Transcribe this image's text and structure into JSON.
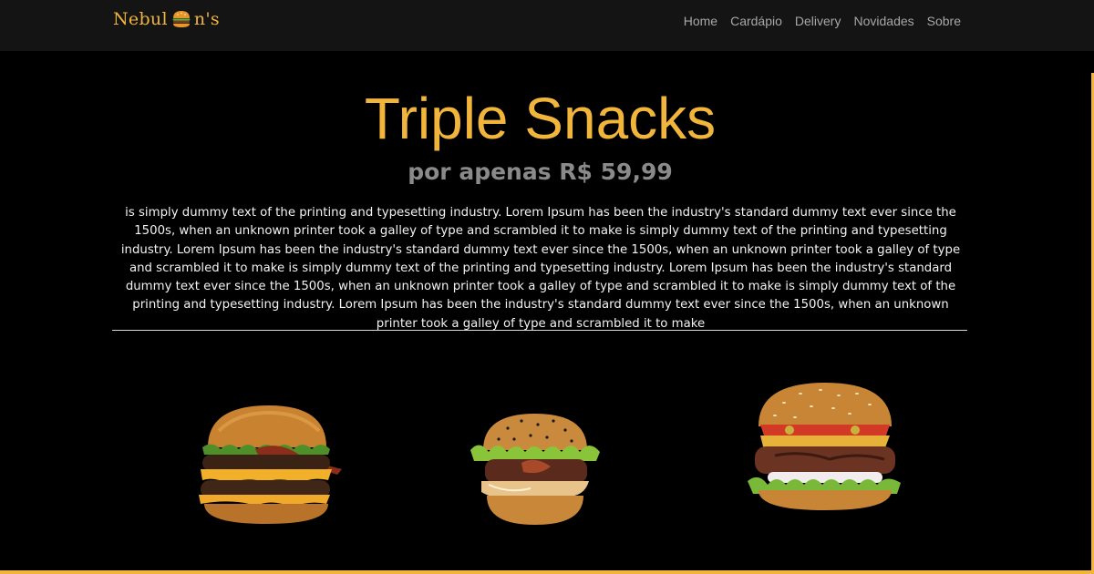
{
  "brand": {
    "name_start": "Nebul",
    "name_end": "n's",
    "logo_icon": "burger-icon"
  },
  "nav": {
    "items": [
      {
        "label": "Home"
      },
      {
        "label": "Cardápio"
      },
      {
        "label": "Delivery"
      },
      {
        "label": "Novidades"
      },
      {
        "label": "Sobre"
      }
    ]
  },
  "hero": {
    "title": "Triple Snacks",
    "subtitle": "por apenas R$ 59,99",
    "description": "is simply dummy text of the printing and typesetting industry. Lorem Ipsum has been the industry's standard dummy text ever since the 1500s, when an unknown printer took a galley of type and scrambled it to make is simply dummy text of the printing and typesetting industry. Lorem Ipsum has been the industry's standard dummy text ever since the 1500s, when an unknown printer took a galley of type and scrambled it to make is simply dummy text of the printing and typesetting industry. Lorem Ipsum has been the industry's standard dummy text ever since the 1500s, when an unknown printer took a galley of type and scrambled it to make is simply dummy text of the printing and typesetting industry. Lorem Ipsum has been the industry's standard dummy text ever since the 1500s, when an unknown printer took a galley of type and scrambled it to make"
  },
  "images": [
    {
      "name": "burger-image-1",
      "icon": "double-cheeseburger-image"
    },
    {
      "name": "burger-image-2",
      "icon": "burger-with-sauce-image"
    },
    {
      "name": "burger-image-3",
      "icon": "cheeseburger-image"
    }
  ],
  "colors": {
    "accent": "#f0b53a",
    "background": "#000000",
    "navbar": "#141414",
    "nav_text": "#a7a7a7",
    "subtitle": "#8a8a8a",
    "body_text": "#f2f2f2"
  }
}
